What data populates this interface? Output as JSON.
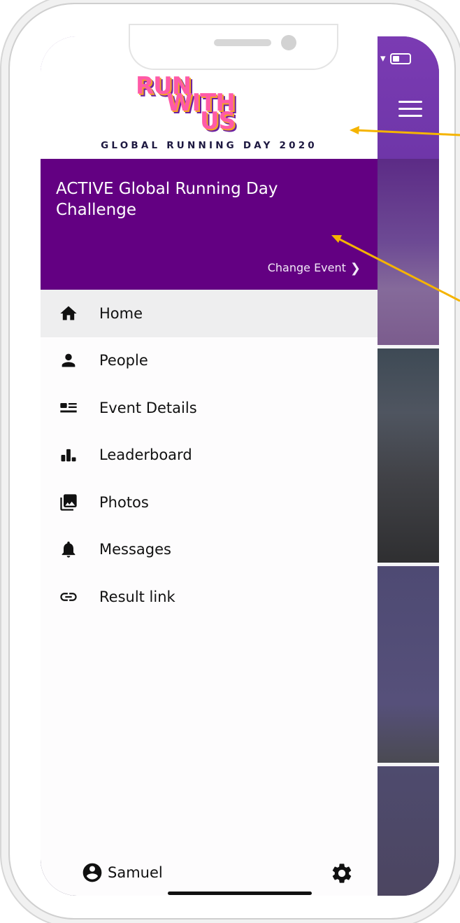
{
  "status_bar": {
    "wifi_icon": "wifi-icon",
    "battery_icon": "battery-icon"
  },
  "background_app": {
    "menu_icon": "hamburger-icon"
  },
  "brand": {
    "logo_line1": "RUN",
    "logo_line2": "WITH",
    "logo_line3": "US",
    "tagline": "GLOBAL RUNNING DAY 2020"
  },
  "event": {
    "title": "ACTIVE Global Running Day Challenge",
    "change_label": "Change Event",
    "change_icon": "chevron-right-icon",
    "banner_color": "#630082"
  },
  "nav": {
    "items": [
      {
        "label": "Home",
        "icon": "home-icon",
        "active": true
      },
      {
        "label": "People",
        "icon": "person-icon"
      },
      {
        "label": "Event Details",
        "icon": "event-details-icon"
      },
      {
        "label": "Leaderboard",
        "icon": "leaderboard-icon"
      },
      {
        "label": "Photos",
        "icon": "photos-icon"
      },
      {
        "label": "Messages",
        "icon": "bell-icon"
      },
      {
        "label": "Result link",
        "icon": "link-icon"
      }
    ]
  },
  "footer": {
    "user_name": "Samuel",
    "user_icon": "account-circle-icon",
    "settings_icon": "gear-icon"
  },
  "annotation_color": "#f5b400"
}
